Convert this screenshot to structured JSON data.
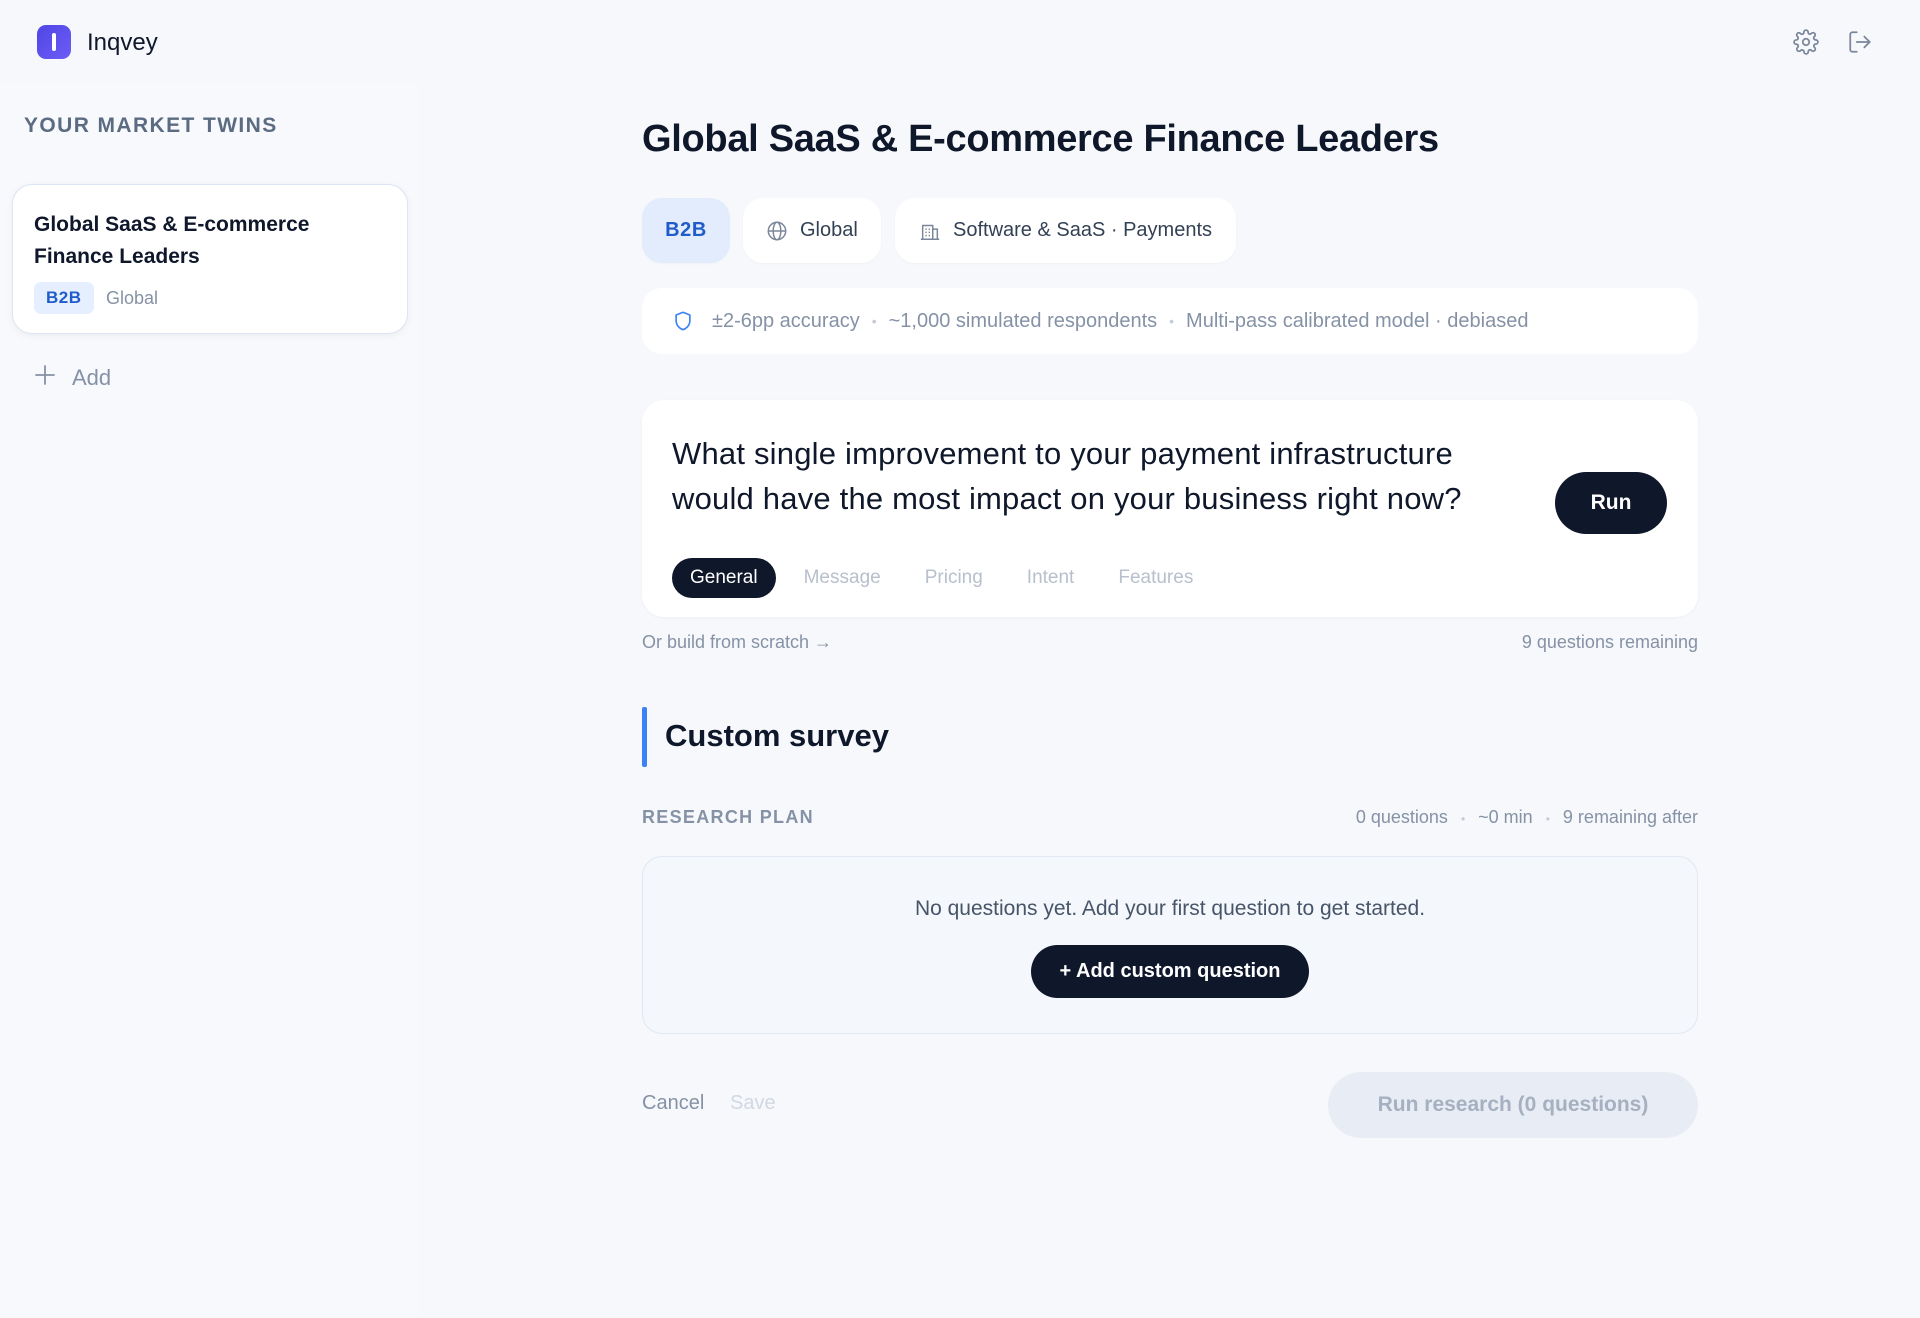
{
  "app": {
    "name": "Inqvey"
  },
  "icons": {
    "logo": "logo-icon",
    "settings": "gear-icon",
    "logout": "logout-icon",
    "add": "plus-icon",
    "region": "globe-icon",
    "industry": "building-icon",
    "accuracy": "shield-icon"
  },
  "colors": {
    "brand": "#4f46e5",
    "primary_dark": "#0f172a",
    "accent_blue": "#3b82f6",
    "badge_bg": "#e3ecfc",
    "badge_text": "#1f5cc9"
  },
  "sidebar": {
    "title": "YOUR MARKET TWINS",
    "twins": [
      {
        "name": "Global SaaS & E-commerce Finance Leaders",
        "badge": "B2B",
        "region": "Global"
      }
    ],
    "add_label": "Add"
  },
  "main": {
    "title": "Global SaaS & E-commerce Finance Leaders",
    "chips": {
      "type": "B2B",
      "region": "Global",
      "industry": "Software & SaaS · Payments"
    },
    "accuracy": {
      "accuracy_text": "±2-6pp accuracy",
      "respondents_text": "~1,000 simulated respondents",
      "model_text": "Multi-pass calibrated model · debiased"
    },
    "question": {
      "text": "What single improvement to your payment infrastructure would have the most impact on your business right now?",
      "run_label": "Run",
      "categories": [
        "General",
        "Message",
        "Pricing",
        "Intent",
        "Features"
      ],
      "selected_category": "General"
    },
    "scratch_link": "Or build from scratch →",
    "remaining": "9 questions remaining",
    "custom_survey": {
      "title": "Custom survey",
      "plan_label": "RESEARCH PLAN",
      "meta": {
        "questions": "0 questions",
        "duration": "~0 min",
        "remaining_after": "9 remaining after"
      },
      "empty_text": "No questions yet. Add your first question to get started.",
      "add_question_label": "+ Add custom question"
    },
    "footer": {
      "cancel_label": "Cancel",
      "save_label": "Save",
      "run_research_label": "Run research (0 questions)"
    }
  }
}
